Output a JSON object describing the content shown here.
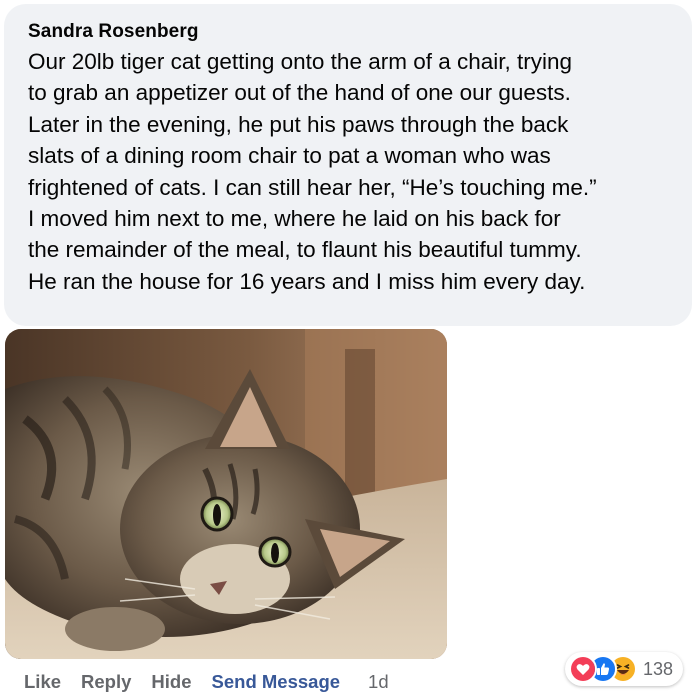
{
  "comment": {
    "author": "Sandra Rosenberg",
    "text": "Our 20lb tiger cat getting onto the arm of a chair, trying to grab an appetizer out of the hand of one our guests. Later in the evening, he put his paws through the back slats of a dining room chair to pat a woman who was frightened of cats. I can still hear her, “He’s touching me.” I moved him next to me, where he laid on his back for the remainder of the meal, to flaunt his beautiful tummy. He ran the house for 16 years and I miss him every day.",
    "text_lines": [
      "Our 20lb tiger cat getting onto the arm of a chair, trying",
      "to grab an appetizer out of the hand of one our guests.",
      "Later in the evening, he put his paws through the back",
      "slats of a dining room chair to pat a woman who was",
      "frightened of cats. I can still hear her, “He’s touching me.”",
      "I moved him next to me, where he laid on his back for",
      "the remainder of the meal, to flaunt his beautiful tummy.",
      "He ran the house for 16 years and I miss him every day."
    ]
  },
  "photo": {
    "subject": "tabby cat lying on carpet"
  },
  "actions": {
    "like": "Like",
    "reply": "Reply",
    "hide": "Hide",
    "send_message": "Send Message",
    "time": "1d"
  },
  "reactions": {
    "icons": [
      "love-icon",
      "like-icon",
      "haha-icon"
    ],
    "count": "138"
  },
  "colors": {
    "bubble_bg": "#f0f2f5",
    "action_gray": "#65676b",
    "link_blue": "#385898",
    "like_blue": "#1877f2",
    "love_red": "#f33e58",
    "haha_yellow": "#f7b125"
  }
}
